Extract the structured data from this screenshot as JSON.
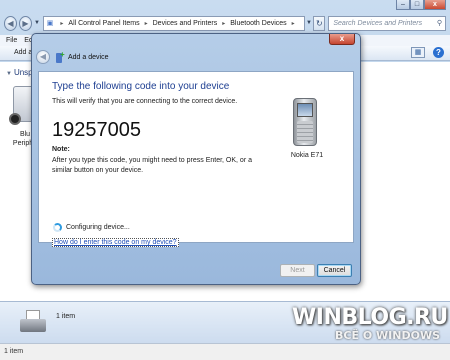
{
  "explorer": {
    "address": [
      "All Control Panel Items",
      "Devices and Printers",
      "Bluetooth Devices"
    ],
    "search_placeholder": "Search Devices and Printers",
    "menu": [
      "File",
      "Ed"
    ],
    "command_add": "Add a d",
    "group_header": "Unsp",
    "device_label_1": "Blu",
    "device_label_2": "Periphe",
    "details_count": "1 item",
    "status_text": "1 item",
    "window_controls": {
      "minimize": "–",
      "maximize": "□",
      "close": "x"
    }
  },
  "dialog": {
    "title": "Add a device",
    "heading": "Type the following code into your device",
    "subtext": "This will verify that you are connecting to the correct device.",
    "code": "19257005",
    "note_label": "Note:",
    "note_text": "After you type this code, you might need to press Enter, OK, or a similar button on your device.",
    "device_name": "Nokia E71",
    "status": "Configuring device...",
    "help_link": "How do I enter this code on my device?",
    "buttons": {
      "next": "Next",
      "cancel": "Cancel"
    },
    "close_glyph": "x"
  },
  "watermark": {
    "main": "WINBLOG.RU",
    "sub": "ВСЁ О WINDOWS"
  },
  "icons": {
    "back": "back-arrow-icon",
    "forward": "forward-arrow-icon",
    "refresh": "refresh-icon",
    "search": "search-icon",
    "help": "help-icon",
    "phone": "mobile-phone-icon",
    "bluetooth_device": "bluetooth-peripheral-icon",
    "printer": "printer-icon",
    "add_device": "add-device-icon",
    "spinner": "busy-spinner-icon"
  }
}
